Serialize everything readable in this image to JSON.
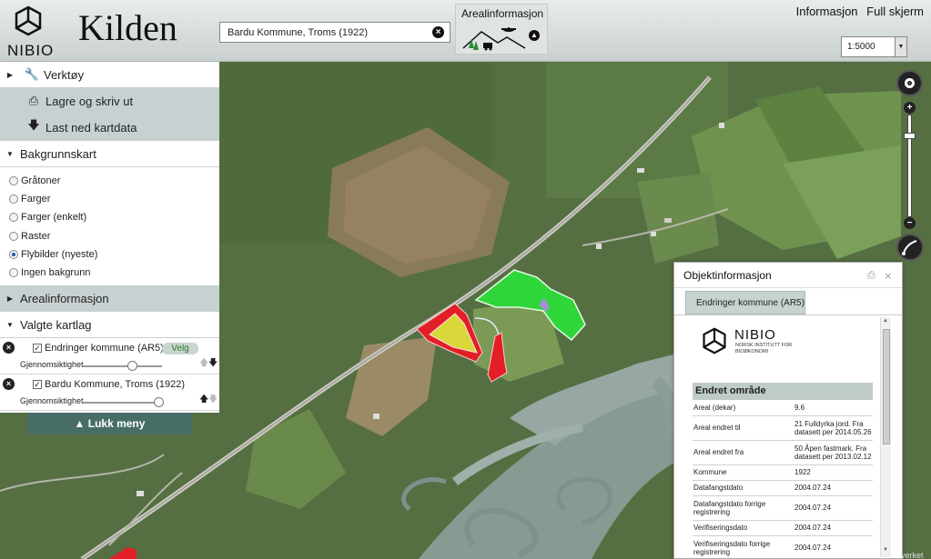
{
  "header": {
    "brand": "NIBIO",
    "app_title": "Kilden",
    "search_value": "Bardu Kommune, Troms (1922)",
    "topic_label": "Arealinformasjon",
    "links": [
      "Informasjon",
      "Full skjerm"
    ],
    "scale_value": "1:5000"
  },
  "panel": {
    "tools_label": "Verktøy",
    "print_label": "Lagre og skriv ut",
    "download_label": "Last ned kartdata",
    "background_label": "Bakgrunnskart",
    "background_options": [
      {
        "label": "Gråtoner",
        "selected": false
      },
      {
        "label": "Farger",
        "selected": false
      },
      {
        "label": "Farger (enkelt)",
        "selected": false
      },
      {
        "label": "Raster",
        "selected": false
      },
      {
        "label": "Flybilder (nyeste)",
        "selected": true
      },
      {
        "label": "Ingen bakgrunn",
        "selected": false
      }
    ],
    "area_info_label": "Arealinformasjon",
    "selected_layers_label": "Valgte kartlag",
    "layers": [
      {
        "name": "Endringer kommune (AR5)",
        "opacity_label": "Gjennomsiktighet",
        "action": "Velg",
        "opacity": 0.62
      },
      {
        "name": "Bardu Kommune, Troms (1922)",
        "opacity_label": "Gjennomsiktighet",
        "opacity": 0.95
      }
    ],
    "close_menu_label": "Lukk meny"
  },
  "objinfo": {
    "title": "Objektinformasjon",
    "tab": "Endringer kommune (AR5)",
    "logo_word": "NIBIO",
    "logo_sub": "NORSK INSTITUTT FOR BIOØKONOMI",
    "section": "Endret område",
    "rows": [
      {
        "k": "Areal (dekar)",
        "v": "9.6"
      },
      {
        "k": "Areal endret til",
        "v": "21 Fulldyrka jord. Fra datasett per 2014.05.26"
      },
      {
        "k": "Areal endret fra",
        "v": "50 Åpen fastmark. Fra datasett per 2013.02.12"
      },
      {
        "k": "Kommune",
        "v": "1922"
      },
      {
        "k": "Datafangstdato",
        "v": "2004.07.24"
      },
      {
        "k": "Datafangstdato forrige registrering",
        "v": "2004.07.24"
      },
      {
        "k": "Verifiseringsdato",
        "v": "2004.07.24"
      },
      {
        "k": "Verifiseringsdato forrige registrering",
        "v": "2004.07.24"
      }
    ]
  },
  "map": {
    "attribution": "verket"
  },
  "colors": {
    "panel_grey": "#c8d1d1",
    "close_button": "#486d67",
    "polygon_green": "#2fd63a",
    "polygon_red": "#e21f26",
    "polygon_yellow": "#d9d73a"
  }
}
